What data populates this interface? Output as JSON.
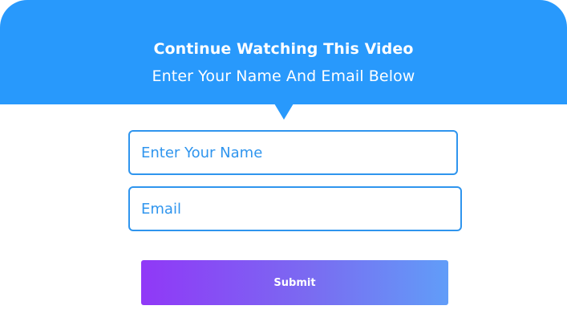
{
  "header": {
    "title": "Continue Watching This Video",
    "subtitle": "Enter Your Name And Email Below"
  },
  "form": {
    "name_field": {
      "placeholder": "Enter Your Name",
      "value": ""
    },
    "email_field": {
      "placeholder": "Email",
      "value": ""
    },
    "submit_label": "Submit"
  },
  "colors": {
    "header_background": "#2899fc",
    "field_border": "#2f95ee",
    "button_gradient_start": "#9038f7",
    "button_gradient_end": "#619df8"
  }
}
